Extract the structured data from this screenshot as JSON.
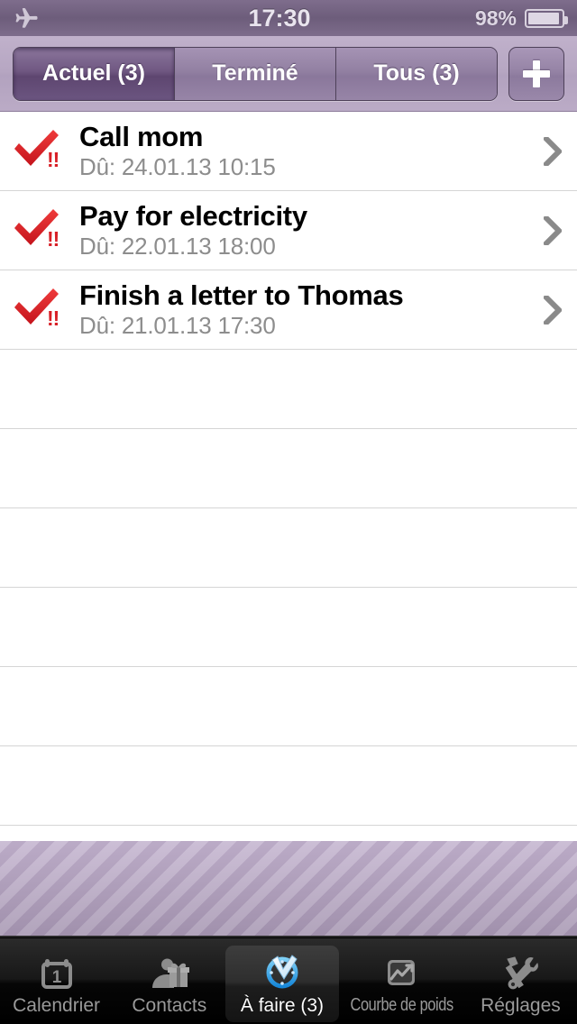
{
  "status_bar": {
    "airplane_icon": "airplane-icon",
    "time": "17:30",
    "battery_percent": "98%",
    "battery_icon": "battery-icon"
  },
  "toolbar": {
    "segments": [
      {
        "label": "Actuel (3)",
        "selected": true
      },
      {
        "label": "Terminé",
        "selected": false
      },
      {
        "label": "Tous (3)",
        "selected": false
      }
    ],
    "add_button": {
      "name": "add-task-button",
      "icon": "plus-icon",
      "label": "+"
    }
  },
  "list": {
    "tasks": [
      {
        "title": "Call mom",
        "due": "Dû: 24.01.13 10:15",
        "priority_badge": "!!",
        "check_icon": "red-checkmark-icon",
        "disclosure_icon": "chevron-right-icon"
      },
      {
        "title": "Pay for electricity",
        "due": "Dû: 22.01.13 18:00",
        "priority_badge": "!!",
        "check_icon": "red-checkmark-icon",
        "disclosure_icon": "chevron-right-icon"
      },
      {
        "title": "Finish a letter to Thomas",
        "due": "Dû: 21.01.13 17:30",
        "priority_badge": "!!",
        "check_icon": "red-checkmark-icon",
        "disclosure_icon": "chevron-right-icon"
      }
    ],
    "empty_row_count": 6
  },
  "tab_bar": {
    "tabs": [
      {
        "label": "Calendrier",
        "icon": "calendar-icon",
        "active": false,
        "calendar_day": "1"
      },
      {
        "label": "Contacts",
        "icon": "contacts-gift-icon",
        "active": false
      },
      {
        "label": "À faire (3)",
        "icon": "todo-clock-icon",
        "active": true
      },
      {
        "label": "Courbe de poids",
        "icon": "weight-chart-icon",
        "active": false
      },
      {
        "label": "Réglages",
        "icon": "tools-icon",
        "active": false
      }
    ]
  },
  "colors": {
    "status_bar_bg": "#6d5d7b",
    "toolbar_bg": "#b6a6c2",
    "segment_selected": "#6f5781",
    "segment_normal": "#9280a2",
    "checkmark_red": "#d81f26",
    "due_text_gray": "#8d8d8d",
    "stripe_light": "#c6b7d1",
    "stripe_dark": "#b3a1c0",
    "tabbar_bg": "#000000",
    "tab_active_blue": "#3aa8e8"
  }
}
